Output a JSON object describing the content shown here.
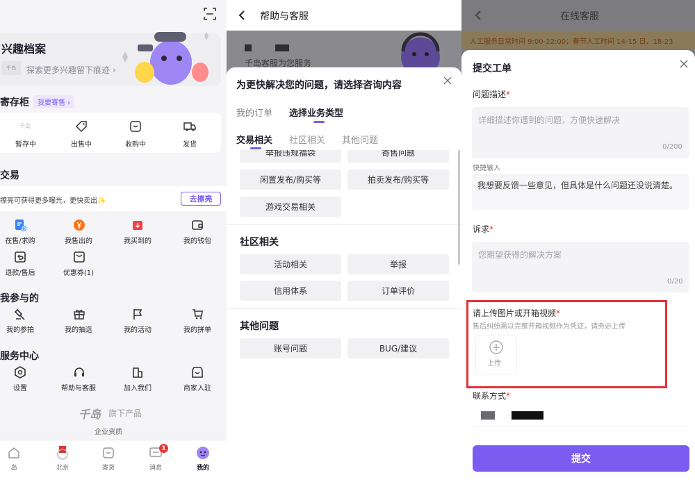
{
  "profile": {
    "interest_title": "兴趣档案",
    "interest_hint": "探索更多兴趣留下痕迹 ›",
    "locker_title": "寄存柜",
    "locker_badge": "我要寄售 ›",
    "locker_items": [
      {
        "label": "暂存中",
        "icon": "box-icon"
      },
      {
        "label": "出售中",
        "icon": "tag-icon"
      },
      {
        "label": "收购中",
        "icon": "inbox-icon"
      },
      {
        "label": "发货",
        "icon": "truck-icon"
      }
    ],
    "trade_title": "交易",
    "promo_text": "擦亮可获得更多曝光，更快卖出✨",
    "promo_button": "去擦亮",
    "trade_items": [
      {
        "label": "在售/求购",
        "icon": "doc-add-icon"
      },
      {
        "label": "我售出的",
        "icon": "yen-icon"
      },
      {
        "label": "我买到的",
        "icon": "bag-icon"
      },
      {
        "label": "我的钱包",
        "icon": "wallet-icon"
      },
      {
        "label": "退款/售后",
        "icon": "refund-icon"
      },
      {
        "label": "优惠券(1)",
        "icon": "coupon-icon"
      }
    ],
    "joined_title": "我参与的",
    "joined_items": [
      {
        "label": "我的参拍",
        "icon": "gavel-icon"
      },
      {
        "label": "我的抽选",
        "icon": "gift-icon"
      },
      {
        "label": "我的活动",
        "icon": "flag-icon"
      },
      {
        "label": "我的拼单",
        "icon": "cart-icon"
      }
    ],
    "service_title": "服务中心",
    "service_items": [
      {
        "label": "设置",
        "icon": "gear-icon"
      },
      {
        "label": "帮助与客服",
        "icon": "headset-icon"
      },
      {
        "label": "加入我们",
        "icon": "building-icon"
      },
      {
        "label": "商家入驻",
        "icon": "store-icon"
      }
    ],
    "brand_logo": "千岛",
    "brand_sub": "旗下产品",
    "enterprise": "企业资质",
    "nav": [
      {
        "label": "岛",
        "icon": "home-icon"
      },
      {
        "label": "北京",
        "icon": "city-icon"
      },
      {
        "label": "寄货",
        "icon": "ship-icon"
      },
      {
        "label": "消息",
        "icon": "message-icon",
        "badge": "1"
      },
      {
        "label": "我的",
        "icon": "me-icon"
      }
    ]
  },
  "help": {
    "header_title": "帮助与客服",
    "banner_text": "千岛客服为您服务",
    "sheet_title": "为更快解决您的问题，请选择咨询内容",
    "tabs": [
      "我的订单",
      "选择业务类型"
    ],
    "subtabs": [
      "交易相关",
      "社区相关",
      "其他问题"
    ],
    "trade_options": [
      "举报违规福袋",
      "寄售问题",
      "闲置发布/购买等",
      "拍卖发布/购买等",
      "游戏交易相关"
    ],
    "community_title": "社区相关",
    "community_options": [
      "活动相关",
      "举报",
      "信用体系",
      "订单评价"
    ],
    "other_title": "其他问题",
    "other_options": [
      "账号问题",
      "BUG/建议"
    ]
  },
  "ticket": {
    "header_title": "在线客服",
    "notice": "人工服务日常时间 9:00-22:00；春节人工时间 14-15 日、18-23",
    "sheet_title": "提交工单",
    "desc_label": "问题描述",
    "desc_placeholder": "详细描述你遇到的问题，方便快速解决",
    "desc_counter": "0/200",
    "quick_label": "快捷输入",
    "quick_text": "我想要反馈一些意见，但具体是什么问题还没说清楚。",
    "appeal_label": "诉求",
    "appeal_placeholder": "您期望获得的解决方案",
    "appeal_counter": "0/20",
    "upload_label": "请上传图片或开箱视频",
    "upload_hint": "售后纠纷需以完整开箱视频作为凭证，请务必上传",
    "upload_button": "上传",
    "contact_label": "联系方式",
    "submit": "提交",
    "required_mark": "*"
  },
  "colors": {
    "accent": "#7b5cf0",
    "highlight": "#e5303a",
    "badge": "#e53935"
  }
}
